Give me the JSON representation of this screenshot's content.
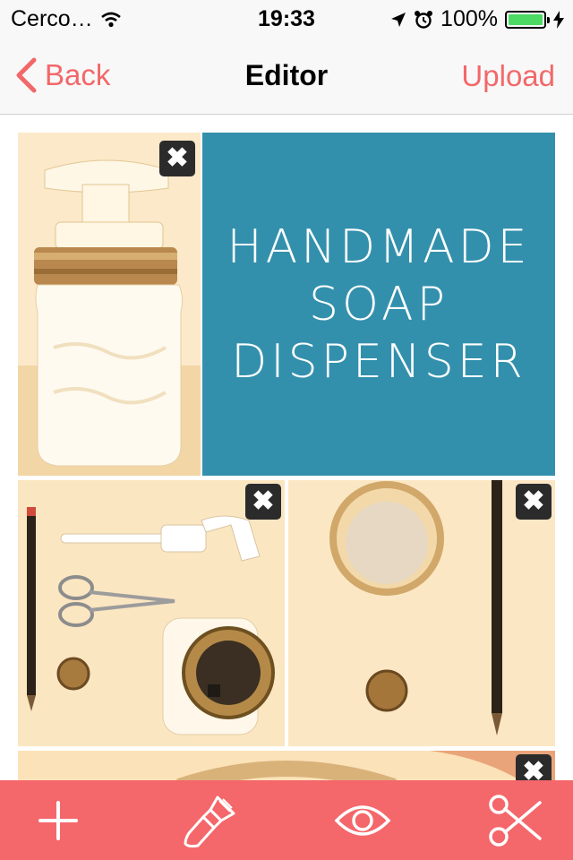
{
  "status_bar": {
    "carrier": "Cerco…",
    "time": "19:33",
    "battery": "100%"
  },
  "nav": {
    "back_label": "Back",
    "title": "Editor",
    "upload_label": "Upload"
  },
  "tiles": {
    "title_lines": [
      "Handmade",
      "Soap",
      "Dispenser"
    ],
    "remove_symbol": "✖"
  },
  "toolbar": {
    "items": [
      "add",
      "brush",
      "preview",
      "cut"
    ]
  },
  "colors": {
    "accent": "#f4676b",
    "title_tile": "#3390ad",
    "battery": "#4cd964"
  }
}
